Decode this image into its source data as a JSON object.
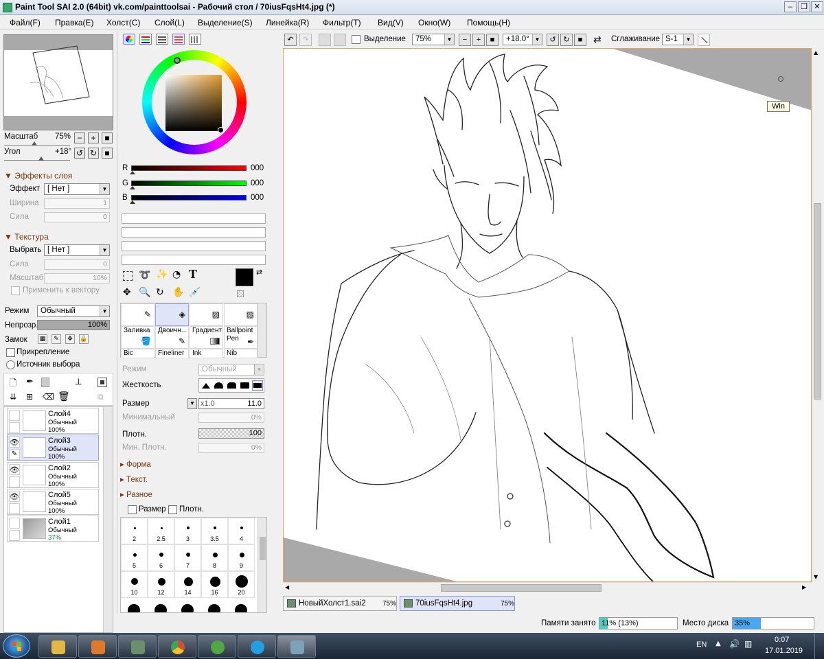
{
  "window": {
    "title": "Paint Tool SAI 2.0 (64bit) vk.com/painttoolsai - Рабочий стол / 70iusFqsHt4.jpg (*)",
    "minimize": "–",
    "maximize": "❐",
    "close": "✕"
  },
  "menu": [
    {
      "label": "Файл(F)"
    },
    {
      "label": "Правка(E)"
    },
    {
      "label": "Холст(C)"
    },
    {
      "label": "Слой(L)"
    },
    {
      "label": "Выделение(S)"
    },
    {
      "label": "Линейка(R)"
    },
    {
      "label": "Фильтр(T)"
    },
    {
      "label": "Вид(V)"
    },
    {
      "label": "Окно(W)"
    },
    {
      "label": "Помощь(H)"
    }
  ],
  "navigator": {
    "zoom_label": "Масштаб",
    "zoom_value": "75%",
    "angle_label": "Угол",
    "angle_value": "+18°"
  },
  "layer_effects": {
    "section": "Эффекты слоя",
    "effect_label": "Эффект",
    "effect_value": "[ Нет ]",
    "width_label": "Ширина",
    "width_value": "1",
    "strength_label": "Сила",
    "strength_value": "0"
  },
  "texture": {
    "section": "Текстура",
    "select_label": "Выбрать",
    "select_value": "[ Нет ]",
    "strength_label": "Сила",
    "strength_value": "0",
    "scale_label": "Масштаб",
    "scale_value": "10%",
    "apply_vector_label": "Применить к вектору"
  },
  "layer_props": {
    "mode_label": "Режим",
    "mode_value": "Обычный",
    "opacity_label": "Непрозр.",
    "opacity_value": "100%",
    "lock_label": "Замок",
    "clip_label": "Прикрепление",
    "source_label": "Источник выбора"
  },
  "layers": [
    {
      "name": "Слой4",
      "mode": "Обычный",
      "opacity": "100%",
      "visible": false,
      "selected": false
    },
    {
      "name": "Слой3",
      "mode": "Обычный",
      "opacity": "100%",
      "visible": true,
      "selected": true
    },
    {
      "name": "Слой2",
      "mode": "Обычный",
      "opacity": "100%",
      "visible": true,
      "selected": false
    },
    {
      "name": "Слой5",
      "mode": "Обычный",
      "opacity": "100%",
      "visible": true,
      "selected": false
    },
    {
      "name": "Слой1",
      "mode": "Обычный",
      "opacity": "37%",
      "visible": false,
      "selected": false
    }
  ],
  "color": {
    "r_label": "R",
    "r_value": "000",
    "g_label": "G",
    "g_value": "000",
    "b_label": "B",
    "b_value": "000",
    "current": "#000000"
  },
  "tools_row1": [
    {
      "label": "",
      "icon": "pencil-icon"
    },
    {
      "label": "",
      "icon": "eraser-icon"
    },
    {
      "label": "",
      "icon": "airbrush-icon"
    },
    {
      "label": "",
      "icon": "bucket-icon"
    }
  ],
  "tools_row2": [
    {
      "label": "Заливка",
      "icon": "fill-icon"
    },
    {
      "label": "Двоичн...",
      "icon": "binary-pen-icon"
    },
    {
      "label": "Градиент",
      "icon": "gradient-icon"
    },
    {
      "label": "Ballpoint Pen",
      "icon": "ballpoint-icon"
    }
  ],
  "tools_row3": [
    {
      "label": "Bic"
    },
    {
      "label": "Fineliner"
    },
    {
      "label": "Ink"
    },
    {
      "label": "Nib"
    }
  ],
  "brush_settings": {
    "mode_label": "Режим",
    "mode_value": "Обычный",
    "hardness_label": "Жесткость",
    "size_label": "Размер",
    "size_mult": "x1.0",
    "size_value": "11.0",
    "min_size_label": "Минимальный",
    "min_size_value": "0%",
    "density_label": "Плотн.",
    "density_value": "100",
    "min_density_label": "Мин. Плотн.",
    "min_density_value": "0%",
    "shape_label": "Форма",
    "texture_label": "Текст.",
    "misc_label": "Разное",
    "size_chk_label": "Размер",
    "density_chk_label": "Плотн."
  },
  "brush_sizes": [
    {
      "label": "2",
      "d": 3
    },
    {
      "label": "2.5",
      "d": 3
    },
    {
      "label": "3",
      "d": 4
    },
    {
      "label": "3.5",
      "d": 4
    },
    {
      "label": "4",
      "d": 4
    },
    {
      "label": "5",
      "d": 5
    },
    {
      "label": "6",
      "d": 6
    },
    {
      "label": "7",
      "d": 6
    },
    {
      "label": "8",
      "d": 7
    },
    {
      "label": "9",
      "d": 7
    },
    {
      "label": "10",
      "d": 10
    },
    {
      "label": "12",
      "d": 11
    },
    {
      "label": "14",
      "d": 13
    },
    {
      "label": "16",
      "d": 15
    },
    {
      "label": "20",
      "d": 18
    }
  ],
  "canvas_toolbar": {
    "selection_label": "Выделение",
    "zoom_value": "75%",
    "angle_value": "+18.0°",
    "smoothing_label": "Сглаживание",
    "smoothing_value": "S-1"
  },
  "canvas": {
    "tooltip": "Win"
  },
  "documents": [
    {
      "name": "НовыйХолст1.sai2",
      "zoom": "75%",
      "active": false
    },
    {
      "name": "70iusFqsHt4.jpg",
      "zoom": "75%",
      "active": true
    }
  ],
  "status": {
    "memory_label": "Памяти занято",
    "memory_value": "11% (13%)",
    "memory_fraction": 0.11,
    "disk_label": "Место диска",
    "disk_value": "35%",
    "disk_fraction": 0.35
  },
  "taskbar": {
    "lang": "EN",
    "time": "0:07",
    "date": "17.01.2019",
    "apps": [
      {
        "name": "explorer",
        "color": "#e2b845"
      },
      {
        "name": "media-player",
        "color": "#e07a2b"
      },
      {
        "name": "document-viewer",
        "color": "#6b8f6b"
      },
      {
        "name": "chrome",
        "color": "#d94b3b"
      },
      {
        "name": "utorrent",
        "color": "#4ea844"
      },
      {
        "name": "skype",
        "color": "#1fa0e0"
      },
      {
        "name": "painttool-sai",
        "color": "#7aa2b8"
      }
    ]
  }
}
